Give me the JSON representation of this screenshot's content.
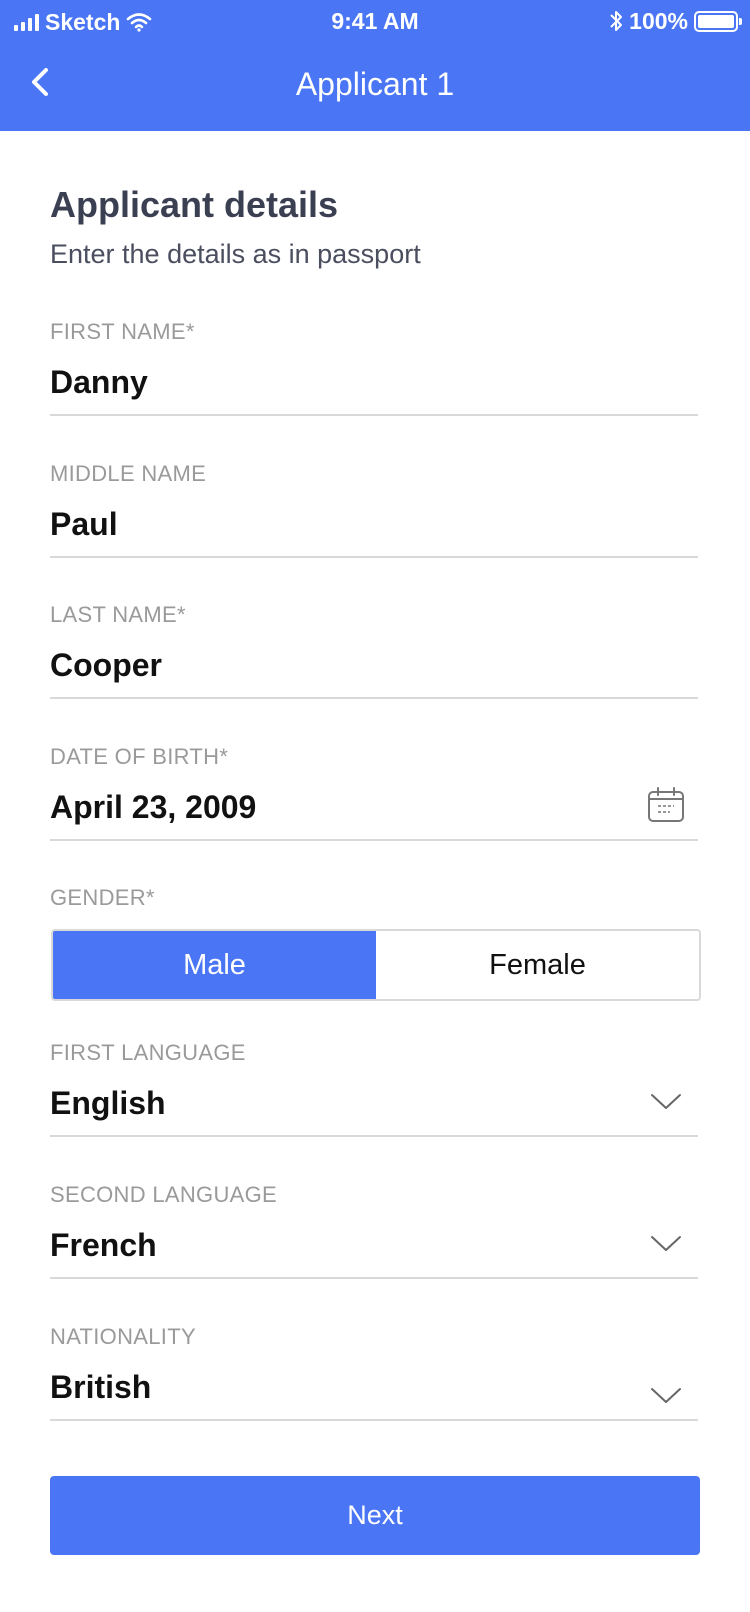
{
  "status_bar": {
    "carrier": "Sketch",
    "time": "9:41 AM",
    "battery": "100%"
  },
  "nav": {
    "title": "Applicant 1"
  },
  "section": {
    "title": "Applicant details",
    "subtitle": "Enter the details as in passport"
  },
  "fields": {
    "first_name": {
      "label": "FIRST NAME*",
      "value": "Danny"
    },
    "middle_name": {
      "label": "MIDDLE NAME",
      "value": "Paul"
    },
    "last_name": {
      "label": "LAST NAME*",
      "value": "Cooper"
    },
    "date_of_birth": {
      "label": "DATE OF BIRTH*",
      "value": "April 23, 2009",
      "icon": "calendar-icon"
    },
    "first_language": {
      "label": "FIRST LANGUAGE",
      "value": "English",
      "icon": "chevron-down-icon"
    },
    "second_language": {
      "label": "SECOND LANGUAGE",
      "value": "French",
      "icon": "chevron-down-icon"
    },
    "nationality": {
      "label": "NATIONALITY",
      "value": "British",
      "icon": "chevron-down-icon"
    }
  },
  "gender": {
    "label": "GENDER*",
    "options": [
      "Male",
      "Female"
    ],
    "selected": "Male"
  },
  "actions": {
    "next_label": "Next"
  },
  "colors": {
    "accent": "#4a76f5",
    "text_dark": "#111111",
    "label_gray": "#9a9a9a",
    "divider": "#d9d9d9"
  }
}
